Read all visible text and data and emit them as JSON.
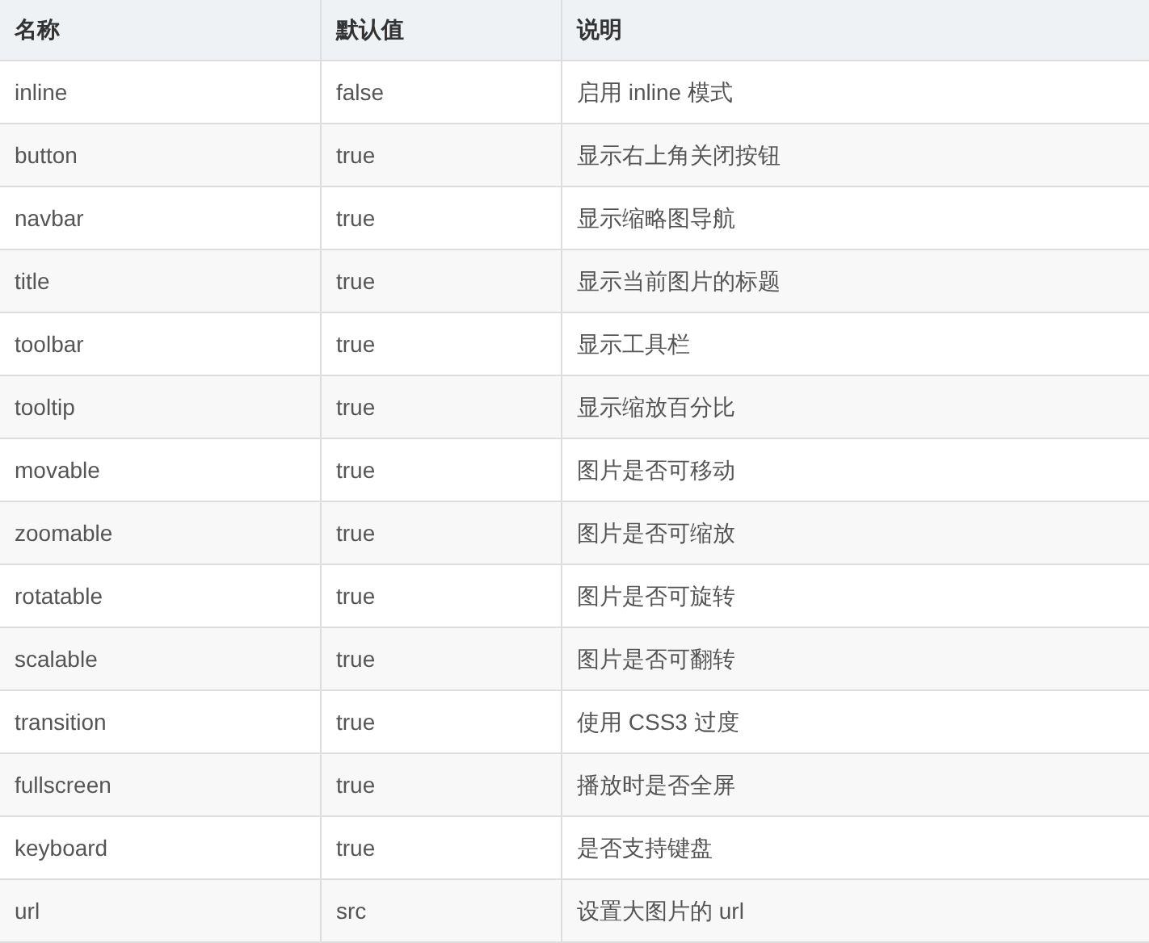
{
  "table": {
    "columns": [
      "名称",
      "默认值",
      "说明"
    ],
    "rows": [
      [
        "inline",
        "false",
        "启用 inline 模式"
      ],
      [
        "button",
        "true",
        "显示右上角关闭按钮"
      ],
      [
        "navbar",
        "true",
        "显示缩略图导航"
      ],
      [
        "title",
        "true",
        "显示当前图片的标题"
      ],
      [
        "toolbar",
        "true",
        "显示工具栏"
      ],
      [
        "tooltip",
        "true",
        "显示缩放百分比"
      ],
      [
        "movable",
        "true",
        "图片是否可移动"
      ],
      [
        "zoomable",
        "true",
        "图片是否可缩放"
      ],
      [
        "rotatable",
        "true",
        "图片是否可旋转"
      ],
      [
        "scalable",
        "true",
        "图片是否可翻转"
      ],
      [
        "transition",
        "true",
        "使用 CSS3 过度"
      ],
      [
        "fullscreen",
        "true",
        "播放时是否全屏"
      ],
      [
        "keyboard",
        "true",
        "是否支持键盘"
      ],
      [
        "url",
        "src",
        "设置大图片的 url"
      ]
    ]
  }
}
